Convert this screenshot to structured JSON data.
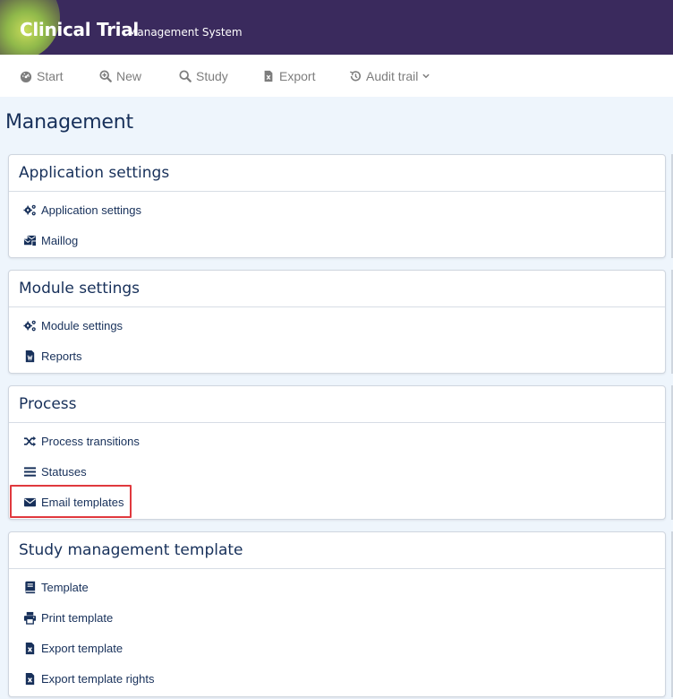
{
  "header": {
    "title": "Clinical Trial",
    "subtitle": "Management System"
  },
  "nav": {
    "start": "Start",
    "new": "New",
    "study": "Study",
    "export": "Export",
    "audit": "Audit trail"
  },
  "page_title": "Management",
  "cards": {
    "app": {
      "title": "Application settings",
      "items": [
        "Application settings",
        "Maillog"
      ]
    },
    "module": {
      "title": "Module settings",
      "items": [
        "Module settings",
        "Reports"
      ]
    },
    "process": {
      "title": "Process",
      "items": [
        "Process transitions",
        "Statuses",
        "Email templates"
      ]
    },
    "study": {
      "title": "Study management template",
      "items": [
        "Template",
        "Print template",
        "Export template",
        "Export template rights"
      ]
    }
  },
  "colors": {
    "header_bg": "#3a2a5d",
    "text": "#17305a",
    "highlight": "#e0393e",
    "page_bg": "#eef5fc"
  }
}
